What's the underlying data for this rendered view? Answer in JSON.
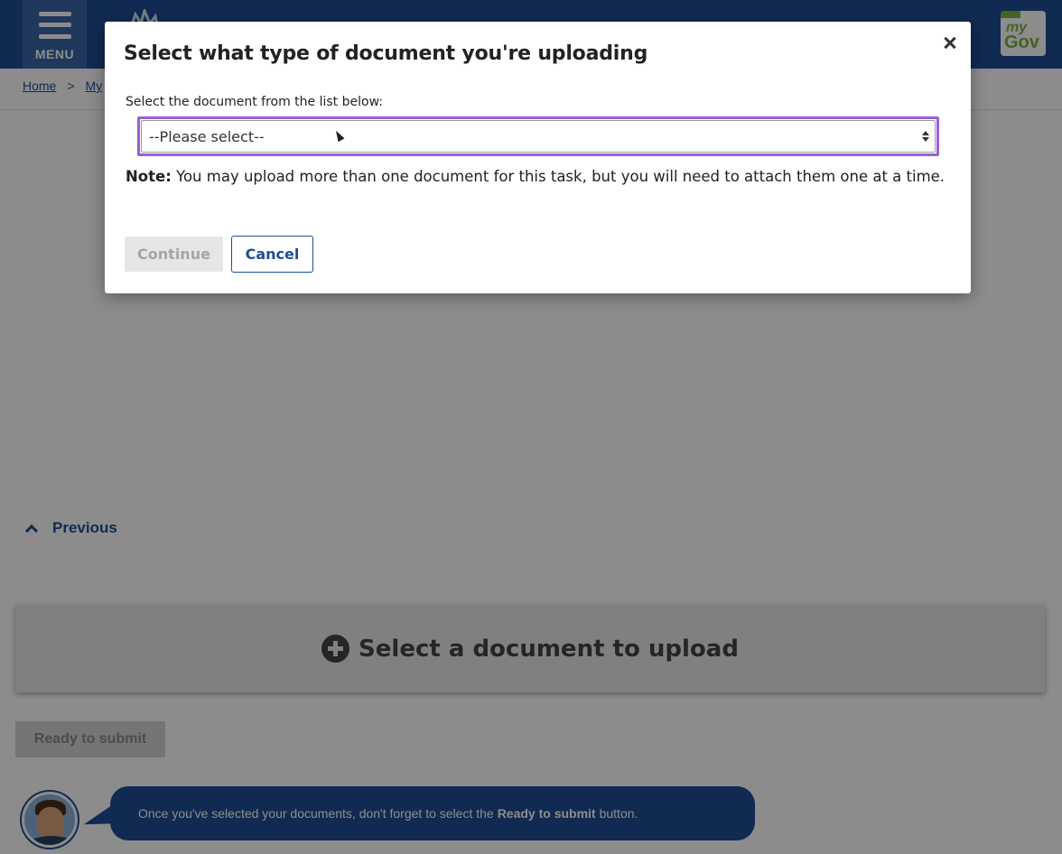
{
  "header": {
    "menu_label": "MENU",
    "logo_top": "my",
    "logo_bottom": "Gov"
  },
  "breadcrumb": {
    "home": "Home",
    "separator": ">",
    "current": "My"
  },
  "page": {
    "previous_label": "Previous",
    "select_document_label": "Select a document to upload",
    "ready_button_label": "Ready to submit",
    "tip_prefix": "Once you've selected your documents, don't forget to select the",
    "tip_bold": "Ready to submit",
    "tip_suffix": "button."
  },
  "modal": {
    "title": "Select what type of document you're uploading",
    "field_label": "Select the document from the list below:",
    "select_value": "--Please select--",
    "note_label": "Note:",
    "note_text": "You may upload more than one document for this task, but you will need to attach them one at a time.",
    "continue_label": "Continue",
    "cancel_label": "Cancel"
  },
  "colors": {
    "brand_blue": "#1f4e96",
    "focus_purple": "#9a5fd6",
    "mygov_green": "#7cb342"
  },
  "icons": [
    "hamburger-icon",
    "crest-icon",
    "mygov-logo",
    "chevron-up-icon",
    "plus-circle-icon",
    "close-icon",
    "select-arrows-icon",
    "mouse-cursor-icon"
  ]
}
